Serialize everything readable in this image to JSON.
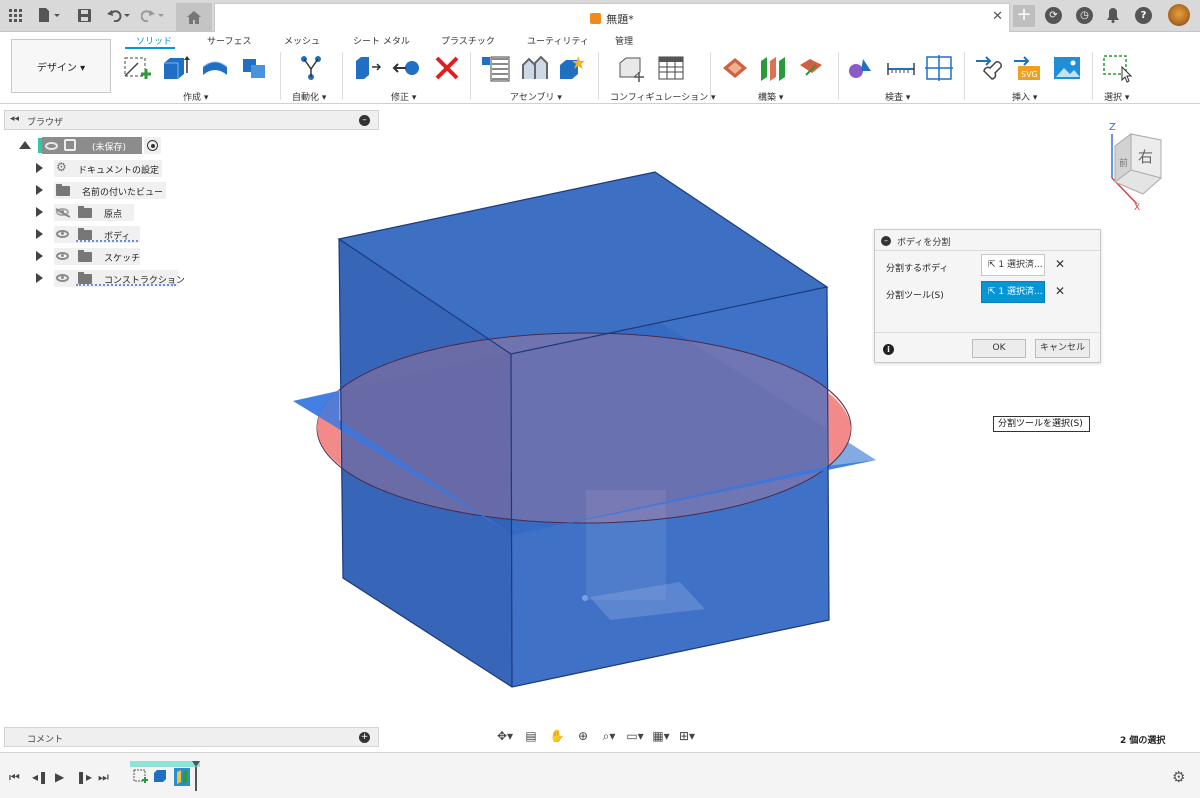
{
  "titlebar": {
    "doc_title": "無題*",
    "icons": [
      "app-grid-icon",
      "file-icon",
      "save-icon",
      "undo-icon",
      "redo-icon",
      "home-icon",
      "close-icon",
      "new-tab-icon",
      "extension-icon",
      "job-status-icon",
      "notification-icon",
      "help-icon",
      "user-avatar"
    ]
  },
  "ribbon": {
    "workspace": "デザイン ▾",
    "tabs": [
      {
        "label": "ソリッド",
        "active": true
      },
      {
        "label": "サーフェス"
      },
      {
        "label": "メッシュ"
      },
      {
        "label": "シート メタル"
      },
      {
        "label": "プラスチック"
      },
      {
        "label": "ユーティリティ"
      },
      {
        "label": "管理"
      }
    ],
    "groups": [
      "作成 ▾",
      "自動化 ▾",
      "修正 ▾",
      "アセンブリ ▾",
      "コンフィギュレーション ▾",
      "構築 ▾",
      "検査 ▾",
      "挿入 ▾",
      "選択 ▾"
    ]
  },
  "browser": {
    "title": "ブラウザ",
    "root": "(未保存)",
    "items": [
      "ドキュメントの設定",
      "名前の付いたビュー",
      "原点",
      "ボディ",
      "スケッチ",
      "コンストラクション"
    ]
  },
  "dialog": {
    "title": "ボディを分割",
    "row1_label": "分割するボディ",
    "row1_value": "1 選択済...",
    "row2_label": "分割ツール(S)",
    "row2_value": "1 選択済...",
    "ok": "OK",
    "cancel": "キャンセル"
  },
  "tooltip": "分割ツールを選択(S)",
  "viewcube": {
    "face": "右",
    "axis_z": "Z",
    "axis_x": "X",
    "side": "前"
  },
  "comments": {
    "title": "コメント"
  },
  "status": {
    "selection": "2 個の選択"
  },
  "colors": {
    "accent": "#0696d7",
    "body": "#2a5fb8",
    "plane": "#4a86d8",
    "circle": "#f08080"
  }
}
